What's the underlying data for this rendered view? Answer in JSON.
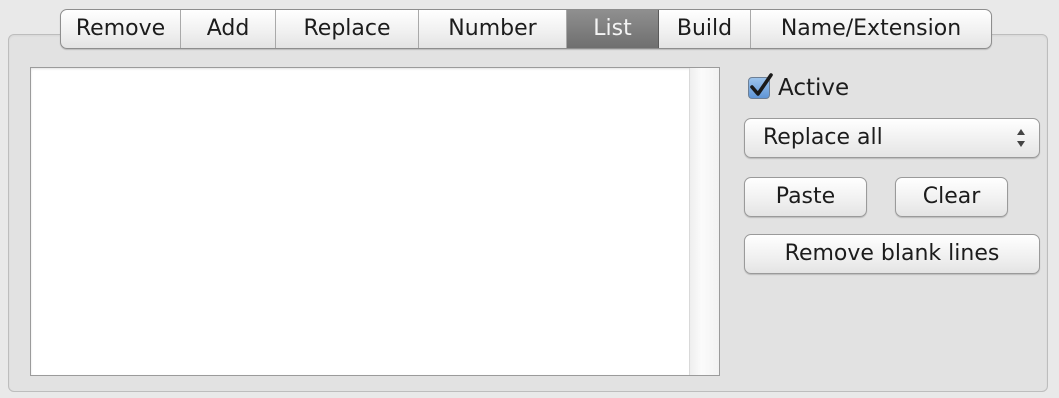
{
  "tabs": [
    {
      "label": "Remove",
      "selected": false
    },
    {
      "label": "Add",
      "selected": false
    },
    {
      "label": "Replace",
      "selected": false
    },
    {
      "label": "Number",
      "selected": false
    },
    {
      "label": "List",
      "selected": true
    },
    {
      "label": "Build",
      "selected": false
    },
    {
      "label": "Name/Extension",
      "selected": false
    }
  ],
  "list_text": "",
  "active_checkbox": {
    "label": "Active",
    "checked": true
  },
  "mode_popup": {
    "selected": "Replace all"
  },
  "buttons": {
    "paste": "Paste",
    "clear": "Clear",
    "remove_blank": "Remove blank lines"
  },
  "colors": {
    "selected_tab": "#7a7a7a",
    "checkbox_blue": "#6fa3df",
    "panel_bg": "#e2e2e2"
  },
  "icons": {
    "checkmark": "checkmark-icon",
    "popup_arrows": "up-down-arrows-icon"
  }
}
